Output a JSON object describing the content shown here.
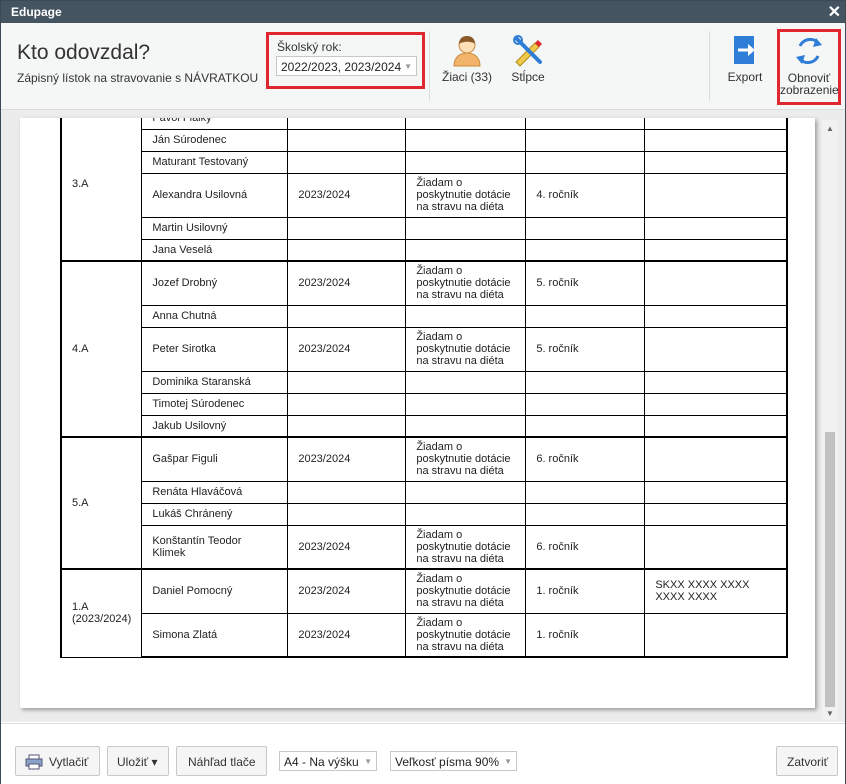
{
  "window": {
    "title": "Edupage",
    "close_icon": "close-icon"
  },
  "header": {
    "title": "Kto odovzdal?",
    "subtitle": "Zápisný lístok na stravovanie s NÁVRATKOU",
    "school_year_label": "Školský rok:",
    "school_year_value": "2022/2023, 2023/2024",
    "students_label": "Žiaci (33)",
    "columns_label": "Stĺpce",
    "export_label": "Export",
    "refresh_label_1": "Obnoviť",
    "refresh_label_2": "zobrazenie"
  },
  "colors": {
    "titlebar": "#455461",
    "highlight": "#e0262e",
    "icon_blue": "#2e7dd6"
  },
  "table": {
    "groups": [
      {
        "class": "3.A",
        "class_sub": "",
        "rows": [
          {
            "name": "Pavol Fialky",
            "year": "",
            "note": "",
            "grade": "",
            "extra": ""
          },
          {
            "name": "Ján Súrodenec",
            "year": "",
            "note": "",
            "grade": "",
            "extra": ""
          },
          {
            "name": "Maturant Testovaný",
            "year": "",
            "note": "",
            "grade": "",
            "extra": ""
          },
          {
            "name": "Alexandra Usilovná",
            "year": "2023/2024",
            "note": "Žiadam o poskytnutie dotácie na stravu na diéta",
            "grade": "4. ročník",
            "extra": ""
          },
          {
            "name": "Martin Usilovný",
            "year": "",
            "note": "",
            "grade": "",
            "extra": ""
          },
          {
            "name": "Jana Veselá",
            "year": "",
            "note": "",
            "grade": "",
            "extra": ""
          }
        ]
      },
      {
        "class": "4.A",
        "class_sub": "",
        "rows": [
          {
            "name": "Jozef Drobný",
            "year": "2023/2024",
            "note": "Žiadam o poskytnutie dotácie na stravu na diéta",
            "grade": "5. ročník",
            "extra": ""
          },
          {
            "name": "Anna Chutná",
            "year": "",
            "note": "",
            "grade": "",
            "extra": ""
          },
          {
            "name": "Peter Sirotka",
            "year": "2023/2024",
            "note": "Žiadam o poskytnutie dotácie na stravu na diéta",
            "grade": "5. ročník",
            "extra": ""
          },
          {
            "name": "Dominika Staranská",
            "year": "",
            "note": "",
            "grade": "",
            "extra": ""
          },
          {
            "name": "Timotej Súrodenec",
            "year": "",
            "note": "",
            "grade": "",
            "extra": ""
          },
          {
            "name": "Jakub Usilovný",
            "year": "",
            "note": "",
            "grade": "",
            "extra": ""
          }
        ]
      },
      {
        "class": "5.A",
        "class_sub": "",
        "rows": [
          {
            "name": "Gašpar Figuli",
            "year": "2023/2024",
            "note": "Žiadam o poskytnutie dotácie na stravu na diéta",
            "grade": "6. ročník",
            "extra": ""
          },
          {
            "name": "Renáta Hlaváčová",
            "year": "",
            "note": "",
            "grade": "",
            "extra": ""
          },
          {
            "name": "Lukáš Chránený",
            "year": "",
            "note": "",
            "grade": "",
            "extra": ""
          },
          {
            "name": "Konštantín Teodor Klimek",
            "year": "2023/2024",
            "note": "Žiadam o poskytnutie dotácie na stravu na diéta",
            "grade": "6. ročník",
            "extra": ""
          }
        ]
      },
      {
        "class": "1.A",
        "class_sub": "(2023/2024)",
        "rows": [
          {
            "name": "Daniel Pomocný",
            "year": "2023/2024",
            "note": "Žiadam o poskytnutie dotácie na stravu na diéta",
            "grade": "1. ročník",
            "extra": "SKXX XXXX XXXX XXXX XXXX"
          },
          {
            "name": "Simona Zlatá",
            "year": "2023/2024",
            "note": "Žiadam o poskytnutie dotácie na stravu na diéta",
            "grade": "1. ročník",
            "extra": ""
          }
        ]
      }
    ]
  },
  "footer": {
    "print_label": "Vytlačiť",
    "save_label": "Uložiť ▾",
    "preview_label": "Náhľad tlače",
    "orientation_value": "A4 - Na výšku",
    "font_size_value": "Veľkosť písma 90%",
    "close_label": "Zatvoriť"
  }
}
